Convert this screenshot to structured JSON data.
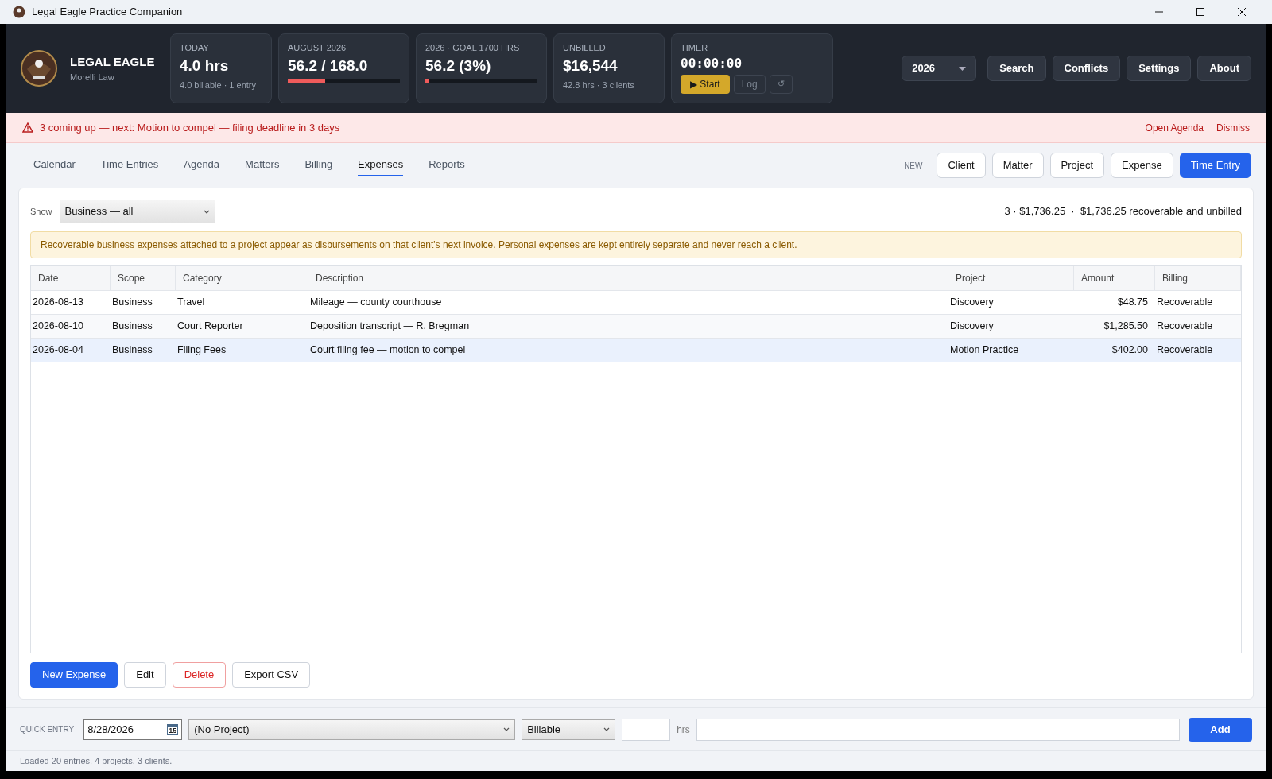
{
  "window": {
    "title": "Legal Eagle Practice Companion"
  },
  "brand": {
    "name": "LEGAL EAGLE",
    "firm": "Morelli Law"
  },
  "stats": [
    {
      "kind": "sub",
      "label": "TODAY",
      "value": "4.0 hrs",
      "sub": "4.0 billable · 1 entry"
    },
    {
      "kind": "bar",
      "label": "AUGUST 2026",
      "value": "56.2 / 168.0",
      "level": 0.33
    },
    {
      "kind": "bar",
      "label": "2026  ·  GOAL 1700 HRS",
      "value": "56.2  (3%)",
      "level": 0.03
    },
    {
      "kind": "sub",
      "label": "UNBILLED",
      "value": "$16,544",
      "sub": "42.8 hrs · 3 clients"
    }
  ],
  "timer": {
    "label": "TIMER",
    "value": "00:00:00",
    "start": "▶ Start",
    "log": "Log",
    "reset": "↺"
  },
  "year_select": "2026",
  "header_buttons": [
    "Search",
    "Conflicts",
    "Settings",
    "About"
  ],
  "alert": {
    "message": "3 coming up — next: Motion to compel — filing deadline in 3 days",
    "actions": [
      "Open Agenda",
      "Dismiss"
    ]
  },
  "tabs": [
    {
      "label": "Calendar",
      "selected": false
    },
    {
      "label": "Time Entries",
      "selected": false
    },
    {
      "label": "Agenda",
      "selected": false
    },
    {
      "label": "Matters",
      "selected": false
    },
    {
      "label": "Billing",
      "selected": false
    },
    {
      "label": "Expenses",
      "selected": true
    },
    {
      "label": "Reports",
      "selected": false
    }
  ],
  "new_label": "NEW",
  "new_buttons": [
    {
      "label": "Client",
      "primary": false
    },
    {
      "label": "Matter",
      "primary": false
    },
    {
      "label": "Project",
      "primary": false
    },
    {
      "label": "Expense",
      "primary": false
    },
    {
      "label": "Time Entry",
      "primary": true
    }
  ],
  "filter": {
    "label": "Show",
    "value": "Business — all"
  },
  "summary": "3 · $1,736.25  ·  $1,736.25 recoverable and unbilled",
  "notice": "Recoverable business expenses attached to a project appear as disbursements on that client's next invoice. Personal expenses are kept entirely separate and never reach a client.",
  "table": {
    "columns": [
      "Date",
      "Scope",
      "Category",
      "Description",
      "Project",
      "Amount",
      "Billing"
    ],
    "rows": [
      {
        "selected": false,
        "cells": [
          "2026-08-13",
          "Business",
          "Travel",
          "Mileage — county courthouse",
          "Discovery",
          "$48.75",
          "Recoverable"
        ]
      },
      {
        "selected": false,
        "cells": [
          "2026-08-10",
          "Business",
          "Court Reporter",
          "Deposition transcript — R. Bregman",
          "Discovery",
          "$1,285.50",
          "Recoverable"
        ]
      },
      {
        "selected": true,
        "cells": [
          "2026-08-04",
          "Business",
          "Filing Fees",
          "Court filing fee — motion to compel",
          "Motion Practice",
          "$402.00",
          "Recoverable"
        ]
      }
    ]
  },
  "actions": [
    {
      "label": "New Expense",
      "kind": "primary"
    },
    {
      "label": "Edit",
      "kind": "plain"
    },
    {
      "label": "Delete",
      "kind": "danger"
    },
    {
      "label": "Export CSV",
      "kind": "plain"
    }
  ],
  "quick_entry": {
    "label": "QUICK ENTRY",
    "date": "8/28/2026",
    "calendar_day": "15",
    "project": "(No Project)",
    "billing": "Billable",
    "hrs_label": "hrs",
    "add": "Add"
  },
  "status_bar": "Loaded 20 entries, 4 projects, 3 clients."
}
